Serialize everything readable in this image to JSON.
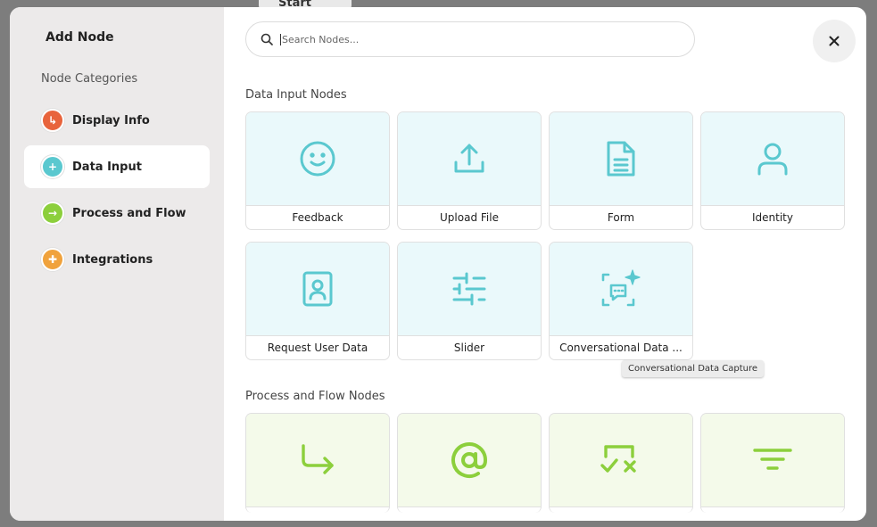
{
  "backdrop": {
    "start_label": "Start"
  },
  "modal": {
    "title": "Add Node",
    "categories_heading": "Node Categories",
    "categories": [
      {
        "label": "Display Info",
        "color": "#e8643c",
        "glyph": "↳",
        "active": false
      },
      {
        "label": "Data Input",
        "color": "#5ac8cf",
        "glyph": "+",
        "active": true
      },
      {
        "label": "Process and Flow",
        "color": "#8ccf3c",
        "glyph": "→",
        "active": false
      },
      {
        "label": "Integrations",
        "color": "#f0a23c",
        "glyph": "✚",
        "active": false
      }
    ],
    "search": {
      "placeholder": "Search Nodes...",
      "value": ""
    },
    "sections": {
      "data_input": {
        "title": "Data Input Nodes",
        "nodes": [
          {
            "label": "Feedback",
            "icon": "smiley-icon"
          },
          {
            "label": "Upload File",
            "icon": "upload-icon"
          },
          {
            "label": "Form",
            "icon": "document-icon"
          },
          {
            "label": "Identity",
            "icon": "user-icon"
          },
          {
            "label": "Request User Data",
            "icon": "id-card-icon"
          },
          {
            "label": "Slider",
            "icon": "sliders-icon"
          },
          {
            "label": "Conversational Data ...",
            "icon": "chat-sparkle-icon"
          }
        ]
      },
      "process_flow": {
        "title": "Process and Flow Nodes",
        "nodes": [
          {
            "label": "",
            "icon": "redirect-arrow-icon"
          },
          {
            "label": "",
            "icon": "at-sign-icon"
          },
          {
            "label": "",
            "icon": "check-x-icon"
          },
          {
            "label": "",
            "icon": "filter-icon"
          }
        ]
      }
    },
    "tooltip": "Conversational Data Capture",
    "colors": {
      "teal_icon": "#5ac8cf",
      "green_icon": "#8ccf3c",
      "teal_bg": "#eaf9fb",
      "green_bg": "#f4faea"
    }
  }
}
